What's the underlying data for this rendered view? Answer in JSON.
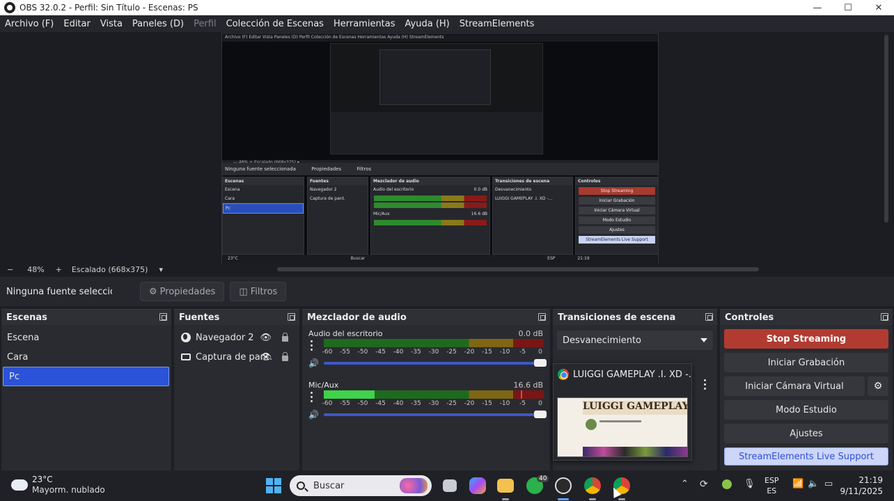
{
  "window": {
    "title": "OBS 32.0.2 - Perfil: Sin Título - Escenas: PS",
    "minimize": "—",
    "maximize": "☐",
    "close": "✕"
  },
  "menu": {
    "items": [
      {
        "label": "Archivo (F)",
        "enabled": true
      },
      {
        "label": "Editar",
        "enabled": true
      },
      {
        "label": "Vista",
        "enabled": true
      },
      {
        "label": "Paneles (D)",
        "enabled": true
      },
      {
        "label": "Perfil",
        "enabled": false
      },
      {
        "label": "Colección de Escenas",
        "enabled": true
      },
      {
        "label": "Herramientas",
        "enabled": true
      },
      {
        "label": "Ayuda (H)",
        "enabled": true
      },
      {
        "label": "StreamElements",
        "enabled": true
      }
    ]
  },
  "preview": {
    "menu_text": "Archivo (F)   Editar   Vista   Paneles (D)   Perfil   Colección de Escenas   Herramientas   Ayuda (H)   StreamElements",
    "toolbar_text": "—  48%  +  Escalado (668x375)  ▾",
    "no_source": "Ninguna fuente seleccionada",
    "props": "Propiedades",
    "filters": "Filtros",
    "scenes_title": "Escenas",
    "scenes": [
      "Escena",
      "Cara",
      "Pc"
    ],
    "sources_title": "Fuentes",
    "sources": [
      "Navegador 2",
      "Captura de pant."
    ],
    "mixer_title": "Mezclador de audio",
    "mixer_ch1": "Audio del escritorio",
    "mixer_ch1_db": "0.0 dB",
    "mixer_ch2": "Mic/Aux",
    "mixer_ch2_db": "16.6 dB",
    "trans_title": "Transiciones de escena",
    "trans_value": "Desvanecimiento",
    "popup_title": "LUIGGI GAMEPLAY .I. XD -...",
    "ctrl_title": "Controles",
    "ctrl_buttons": [
      "Stop Streaming",
      "Iniciar Grabación",
      "Iniciar Cámara Virtual",
      "Modo Estudio",
      "Ajustes",
      "StreamElements Live Support"
    ],
    "taskbar_temp": "23°C",
    "taskbar_search": "Buscar",
    "taskbar_lang": "ESP",
    "taskbar_time": "21:19"
  },
  "zoom": {
    "minus": "−",
    "value": "48%",
    "plus": "+",
    "scaling": "Escalado (668x375)",
    "dropdown": "▾"
  },
  "source_bar": {
    "no_source": "Ninguna fuente seleccionada",
    "properties": "Propiedades",
    "filters": "Filtros"
  },
  "scenes": {
    "title": "Escenas",
    "items": [
      "Escena",
      "Cara",
      "Pc"
    ],
    "selected": "Pc"
  },
  "sources": {
    "title": "Fuentes",
    "items": [
      {
        "name": "Navegador 2",
        "icon": "globe-icon"
      },
      {
        "name": "Captura de pant.",
        "icon": "monitor-icon"
      }
    ]
  },
  "mixer": {
    "title": "Mezclador de audio",
    "scale": [
      "-60",
      "-55",
      "-50",
      "-45",
      "-40",
      "-35",
      "-30",
      "-25",
      "-20",
      "-15",
      "-10",
      "-5",
      "0"
    ],
    "channels": [
      {
        "name": "Audio del escritorio",
        "db": "0.0 dB",
        "level": 0.0,
        "peak": null
      },
      {
        "name": "Mic/Aux",
        "db": "16.6 dB",
        "level": 0.23,
        "peak": 0.895
      }
    ]
  },
  "transitions": {
    "title": "Transiciones de escena",
    "selected": "Desvanecimiento"
  },
  "popup": {
    "title": "LUIGGI GAMEPLAY .I. XD -...",
    "thumb_banner": "LUIGGI GAMEPLAY .I."
  },
  "controls": {
    "title": "Controles",
    "stop_streaming": "Stop Streaming",
    "start_recording": "Iniciar Grabación",
    "start_virtual_cam": "Iniciar Cámara Virtual",
    "studio_mode": "Modo Estudio",
    "settings": "Ajustes",
    "live_support": "StreamElements Live Support"
  },
  "taskbar": {
    "temp": "23°C",
    "condition": "Mayorm. nublado",
    "search_placeholder": "Buscar",
    "lang_top": "ESP",
    "lang_bottom": "ES",
    "time": "21:19",
    "date": "9/11/2025",
    "badge_whatsapp": "40"
  },
  "colors": {
    "accent_selection": "#2a53d9",
    "stop_button": "#b23b31",
    "live_support_bg": "#cdd6f8",
    "meter_green": "#3fd24a"
  }
}
